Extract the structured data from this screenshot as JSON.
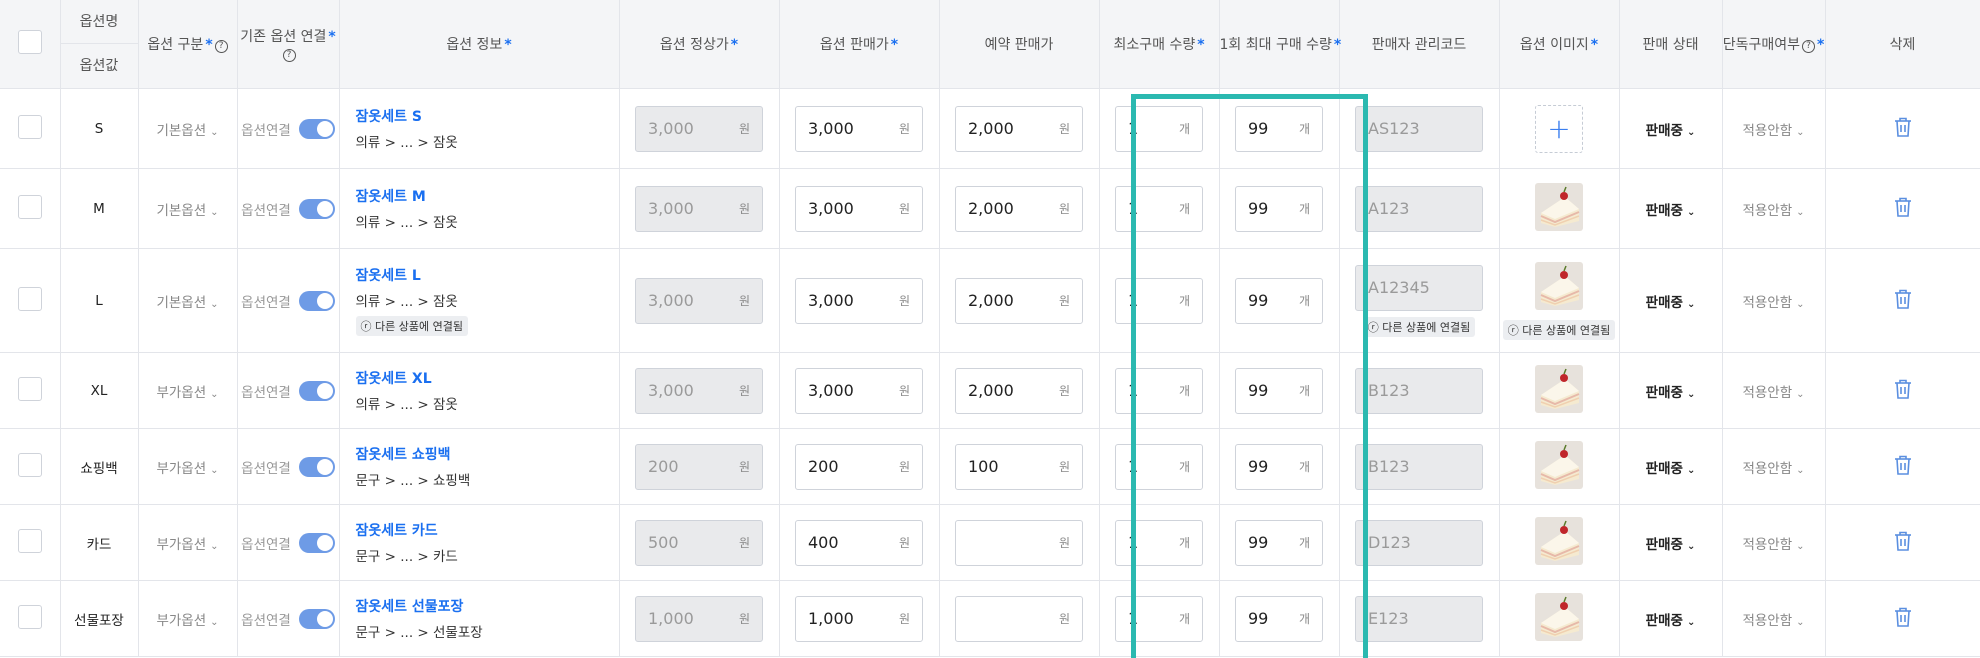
{
  "headers": {
    "option_name": "옵션명",
    "option_value": "옵션값",
    "option_type": "옵션 구분",
    "existing_link": "기존 옵션 연결",
    "option_info": "옵션 정보",
    "regular_price": "옵션 정상가",
    "sale_price": "옵션 판매가",
    "reserve_price": "예약 판매가",
    "min_qty": "최소구매 수량",
    "max_qty": "1회 최대 구매 수량",
    "seller_code": "판매자 관리코드",
    "option_image": "옵션 이미지",
    "sale_status": "판매 상태",
    "single_purchase": "단독구매여부",
    "delete": "삭제"
  },
  "required_mark": "*",
  "help_icon": "?",
  "units": {
    "won": "원",
    "count": "개"
  },
  "linked_badge": "ⓡ 다른 상품에 연결됨",
  "rows": [
    {
      "value": "S",
      "type": "기본옵션",
      "link": "옵션연결",
      "name": "잠옷세트 S",
      "category": "의류 > ... > 잠옷",
      "regular": "3,000",
      "sale": "3,000",
      "reserve": "2,000",
      "min": "1",
      "max": "99",
      "code": "AS123",
      "status": "판매중",
      "single": "적용안함"
    },
    {
      "value": "M",
      "type": "기본옵션",
      "link": "옵션연결",
      "name": "잠옷세트 M",
      "category": "의류 > ... > 잠옷",
      "regular": "3,000",
      "sale": "3,000",
      "reserve": "2,000",
      "min": "1",
      "max": "99",
      "code": "A123",
      "status": "판매중",
      "single": "적용안함"
    },
    {
      "value": "L",
      "type": "기본옵션",
      "link": "옵션연결",
      "name": "잠옷세트 L",
      "category": "의류 > ... > 잠옷",
      "regular": "3,000",
      "sale": "3,000",
      "reserve": "2,000",
      "min": "1",
      "max": "99",
      "code": "A12345",
      "status": "판매중",
      "single": "적용안함"
    },
    {
      "value": "XL",
      "type": "부가옵션",
      "link": "옵션연결",
      "name": "잠옷세트 XL",
      "category": "의류 > ... > 잠옷",
      "regular": "3,000",
      "sale": "3,000",
      "reserve": "2,000",
      "min": "1",
      "max": "99",
      "code": "B123",
      "status": "판매중",
      "single": "적용안함"
    },
    {
      "value": "쇼핑백",
      "type": "부가옵션",
      "link": "옵션연결",
      "name": "잠옷세트 쇼핑백",
      "category": "문구 > ... > 쇼핑백",
      "regular": "200",
      "sale": "200",
      "reserve": "100",
      "min": "1",
      "max": "99",
      "code": "B123",
      "status": "판매중",
      "single": "적용안함"
    },
    {
      "value": "카드",
      "type": "부가옵션",
      "link": "옵션연결",
      "name": "잠옷세트 카드",
      "category": "문구 > ... > 카드",
      "regular": "500",
      "sale": "400",
      "reserve": "",
      "min": "1",
      "max": "99",
      "code": "D123",
      "status": "판매중",
      "single": "적용안함"
    },
    {
      "value": "선물포장",
      "type": "부가옵션",
      "link": "옵션연결",
      "name": "잠옷세트 선물포장",
      "category": "문구 > ... > 선물포장",
      "regular": "1,000",
      "sale": "1,000",
      "reserve": "",
      "min": "1",
      "max": "99",
      "code": "E123",
      "status": "판매중",
      "single": "적용안함"
    }
  ],
  "colors": {
    "accent": "#1a6ff0",
    "highlight": "#2bb9b0",
    "toggle": "#6e9be6",
    "header_bg": "#f4f5f7"
  }
}
